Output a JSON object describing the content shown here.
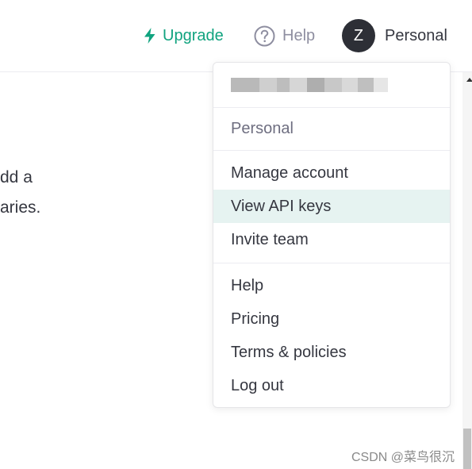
{
  "header": {
    "upgrade_label": "Upgrade",
    "help_label": "Help",
    "avatar_initial": "Z",
    "personal_label": "Personal"
  },
  "background": {
    "line1": "dd a",
    "line2": "aries."
  },
  "menu": {
    "email": "",
    "org": "Personal",
    "account_items": [
      {
        "label": "Manage account"
      },
      {
        "label": "View API keys"
      },
      {
        "label": "Invite team"
      }
    ],
    "misc_items": [
      {
        "label": "Help"
      },
      {
        "label": "Pricing"
      },
      {
        "label": "Terms & policies"
      },
      {
        "label": "Log out"
      }
    ],
    "active_item": "View API keys"
  },
  "watermark": "CSDN @菜鸟很沉",
  "colors": {
    "accent": "#10a37f",
    "avatar_bg": "#2d2f36",
    "active_bg": "#e6f3f1"
  },
  "icons": {
    "upgrade": "lightning-icon",
    "help": "question-circle-icon"
  }
}
